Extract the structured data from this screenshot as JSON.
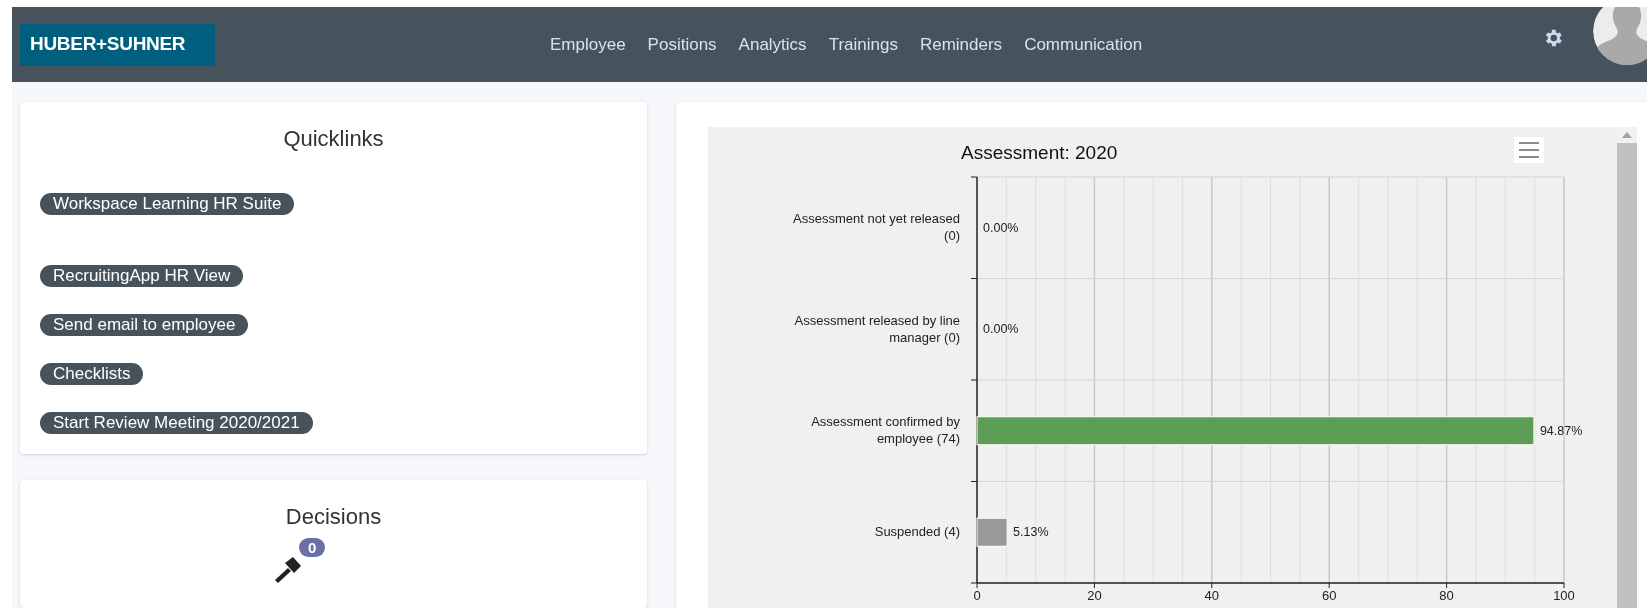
{
  "navbar": {
    "logo": "HUBER+SUHNER",
    "links": [
      "Employee",
      "Positions",
      "Analytics",
      "Trainings",
      "Reminders",
      "Communication"
    ]
  },
  "quicklinks": {
    "title": "Quicklinks",
    "links": [
      "Workspace Learning HR Suite",
      "RecruitingApp HR View",
      "Send email to employee",
      "Checklists",
      "Start Review Meeting 2020/2021"
    ]
  },
  "decisions": {
    "title": "Decisions",
    "count": "0"
  },
  "chart": {
    "chart_data": {
      "type": "bar",
      "orientation": "horizontal",
      "title": "Assessment: 2020",
      "categories": [
        "Assessment not yet released (0)",
        "Assessment released by line manager (0)",
        "Assessment confirmed by employee (74)",
        "Suspended (4)"
      ],
      "series": [
        {
          "color": "#5c9e55",
          "values": [
            0,
            0,
            94.87,
            null
          ]
        },
        {
          "color": "#999999",
          "values": [
            null,
            null,
            null,
            5.13
          ]
        }
      ],
      "grid": true,
      "xlim": [
        0,
        100
      ],
      "xticks": [
        0,
        20,
        40,
        60,
        80,
        100
      ],
      "value_labels": [
        "0.00%",
        "0.00%",
        "94.87%",
        "5.13%"
      ]
    }
  }
}
